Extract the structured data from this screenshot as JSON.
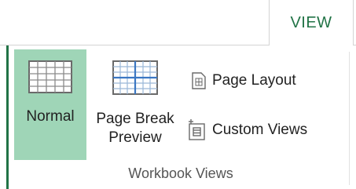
{
  "tabs": {
    "view_label": "VIEW"
  },
  "workbook_views": {
    "group_label": "Workbook Views",
    "normal_label": "Normal",
    "page_break_line1": "Page Break",
    "page_break_line2": "Preview",
    "page_layout_label": "Page Layout",
    "custom_views_label": "Custom Views"
  },
  "icons": {
    "normal": "normal-view-grid-icon",
    "page_break": "page-break-preview-icon",
    "page_layout": "page-layout-icon",
    "custom_views": "custom-views-icon"
  },
  "colors": {
    "accent": "#217346",
    "selected_background": "#9fd5b7"
  }
}
